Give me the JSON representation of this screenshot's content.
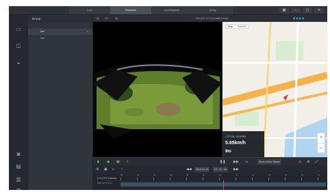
{
  "tabs": [
    "Live",
    "Playback",
    "Investigation",
    "Setup"
  ],
  "active_tab_index": 1,
  "top_right_icons": [
    "grid-icon",
    "minimize-icon",
    "maximize-icon",
    "close-icon"
  ],
  "left_rail_icons": [
    "device-icon",
    "camera-icon",
    "drone-icon",
    "snapshot-icon",
    "monitor-icon",
    "printer-icon",
    "settings-icon"
  ],
  "device_panel": {
    "header": "Drone",
    "items": [
      {
        "label": "test",
        "selected": true
      },
      {
        "label": "test",
        "selected": false
      }
    ]
  },
  "view_header": {
    "page": "1/1",
    "camera_title": "test (127.0.0.1) (Local) (Local)"
  },
  "map": {
    "tabs": [
      "Map",
      "Satellite"
    ],
    "info": {
      "coords": "1.227108, 103.85969",
      "speed": "5.65km/h",
      "altitude": "9m"
    },
    "colors": {
      "road_orange": "#f7b247",
      "road_yellow": "#f3d77a",
      "water": "#a7d2f1",
      "marker_red": "#d83b3b",
      "land": "#f2efe9"
    }
  },
  "controls": {
    "speed": "1x",
    "show_button": "Show Action Status",
    "date": "2019-01-29",
    "time": "00 : 12 : 00"
  },
  "timeline": {
    "channel_label": "(Ch.) PTZ Camera",
    "channel_sub": "test (127.0.0.1)",
    "tick_labels": [
      "00",
      "02",
      "04",
      "06",
      "08",
      "10",
      "12",
      "14",
      "16",
      "18",
      "20",
      "22",
      "24"
    ]
  }
}
